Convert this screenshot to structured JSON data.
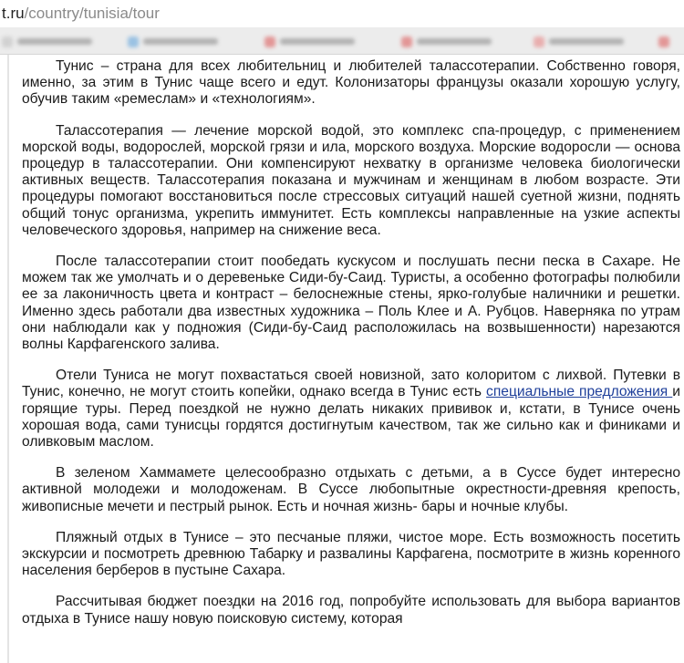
{
  "url": {
    "host": "t.ru",
    "path": "/country/tunisia/tour"
  },
  "bookmarks_colors": [
    "#c9c9c9",
    "#7fb4e0",
    "#e07a7a",
    "#e07a7a",
    "#e89a9a",
    "#e07a7a"
  ],
  "article": {
    "p1": "Тунис – страна для всех любительниц и любителей талассотерапии. Собственно говоря, именно, за этим в Тунис чаще всего и едут. Колонизаторы  французы оказали хорошую услугу, обучив таким «ремеслам» и «технологиям».",
    "p2": "Талассотерапия — лечение морской водой, это комплекс спа-процедур, с применением морской воды, водорослей, морской грязи и ила, морского воздуха. Морские водоросли — основа процедур в талассотерапии. Они компенсируют нехватку в организме человека биологически активных веществ. Талассотерапия показана и мужчинам и женщинам в любом возрасте. Эти процедуры помогают восстановиться после стрессовых ситуаций нашей суетной жизни, поднять общий тонус организма, укрепить иммунитет. Есть комплексы направленные на узкие аспекты человеческого здоровья, например на снижение веса.",
    "p3": "После талассотерапии стоит пообедать кускусом и послушать песни песка в Сахаре.  Не можем так же умолчать и о деревеньке Сиди-бу-Саид. Туристы, а особенно фотографы полюбили ее за лаконичность цвета и контраст – белоснежные стены, ярко-голубые наличники и решетки. Именно здесь работали два известных художника – Поль Клее и А. Рубцов. Наверняка по утрам они наблюдали как у подножия (Сиди-бу-Саид расположилась на возвышенности) нарезаются волны Карфагенского залива.",
    "p4_before": "Отели Туниса не могут похвастаться своей новизной, зато колоритом с лихвой. Путевки в Тунис, конечно, не могут стоить копейки, однако всегда в Тунис есть ",
    "p4_link": "специальные предложения ",
    "p4_after": "и горящие туры. Перед поездкой не нужно делать никаких прививок и, кстати, в Тунисе очень хорошая вода, сами тунисцы гордятся достигнутым качеством, так же сильно как и финиками и оливковым маслом.",
    "p5": "В зеленом Хаммамете целесообразно отдыхать с детьми, а в Суссе будет интересно активной молодежи и молодоженам. В Суссе любопытные  окрестности-древняя крепость, живописные мечети и пестрый рынок. Есть и ночная жизнь- бары и ночные клубы.",
    "p6": "Пляжный отдых в Тунисе – это песчаные пляжи, чистое море. Есть возможность посетить экскурсии и посмотреть древнюю Табарку и развалины Карфагена, посмотрите в жизнь коренного населения берберов в пустыне Сахара.",
    "p7": "Рассчитывая бюджет поездки на 2016 год, попробуйте использовать для выбора вариантов отдыха в Тунисе нашу новую поисковую систему, которая"
  }
}
